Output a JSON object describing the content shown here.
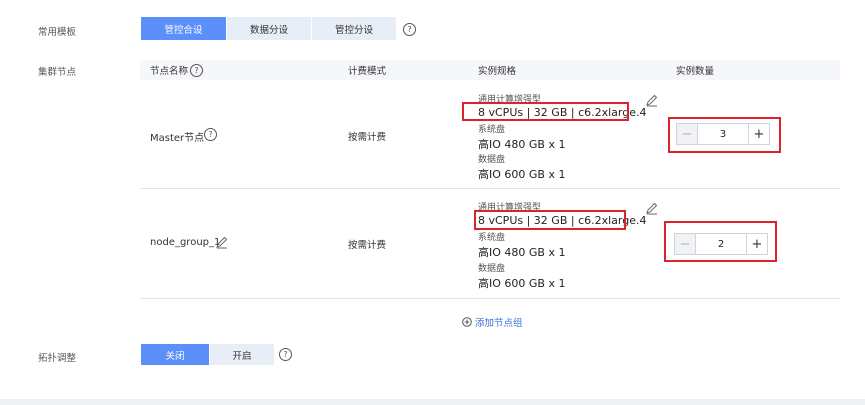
{
  "template": {
    "label": "常用模板",
    "options": [
      "管控合设",
      "数据分设",
      "管控分设"
    ],
    "selected_index": 0
  },
  "cluster": {
    "label": "集群节点",
    "headers": {
      "node_name": "节点名称",
      "billing": "计费模式",
      "spec": "实例规格",
      "count": "实例数量"
    },
    "rows": [
      {
        "name": "Master节点",
        "billing": "按需计费",
        "spec_type": "通用计算增强型",
        "spec_value": "8 vCPUs | 32 GB | c6.2xlarge.4",
        "sys_disk_label": "系统盘",
        "sys_disk_value": "高IO 480 GB x 1",
        "data_disk_label": "数据盘",
        "data_disk_value": "高IO 600 GB x 1",
        "count": "3"
      },
      {
        "name": "node_group_1",
        "billing": "按需计费",
        "spec_type": "通用计算增强型",
        "spec_value": "8 vCPUs | 32 GB | c6.2xlarge.4",
        "sys_disk_label": "系统盘",
        "sys_disk_value": "高IO 480 GB x 1",
        "data_disk_label": "数据盘",
        "data_disk_value": "高IO 600 GB x 1",
        "count": "2"
      }
    ],
    "add_group": "添加节点组"
  },
  "topology": {
    "label": "拓扑调整",
    "options": [
      "关闭",
      "开启"
    ],
    "selected_index": 0
  },
  "icons": {
    "help": "help-circle-icon",
    "edit": "pencil-icon",
    "add": "plus-circle-icon"
  },
  "colors": {
    "accent": "#5b8ff9",
    "highlight": "#d9232d",
    "link": "#3a6fd8"
  }
}
